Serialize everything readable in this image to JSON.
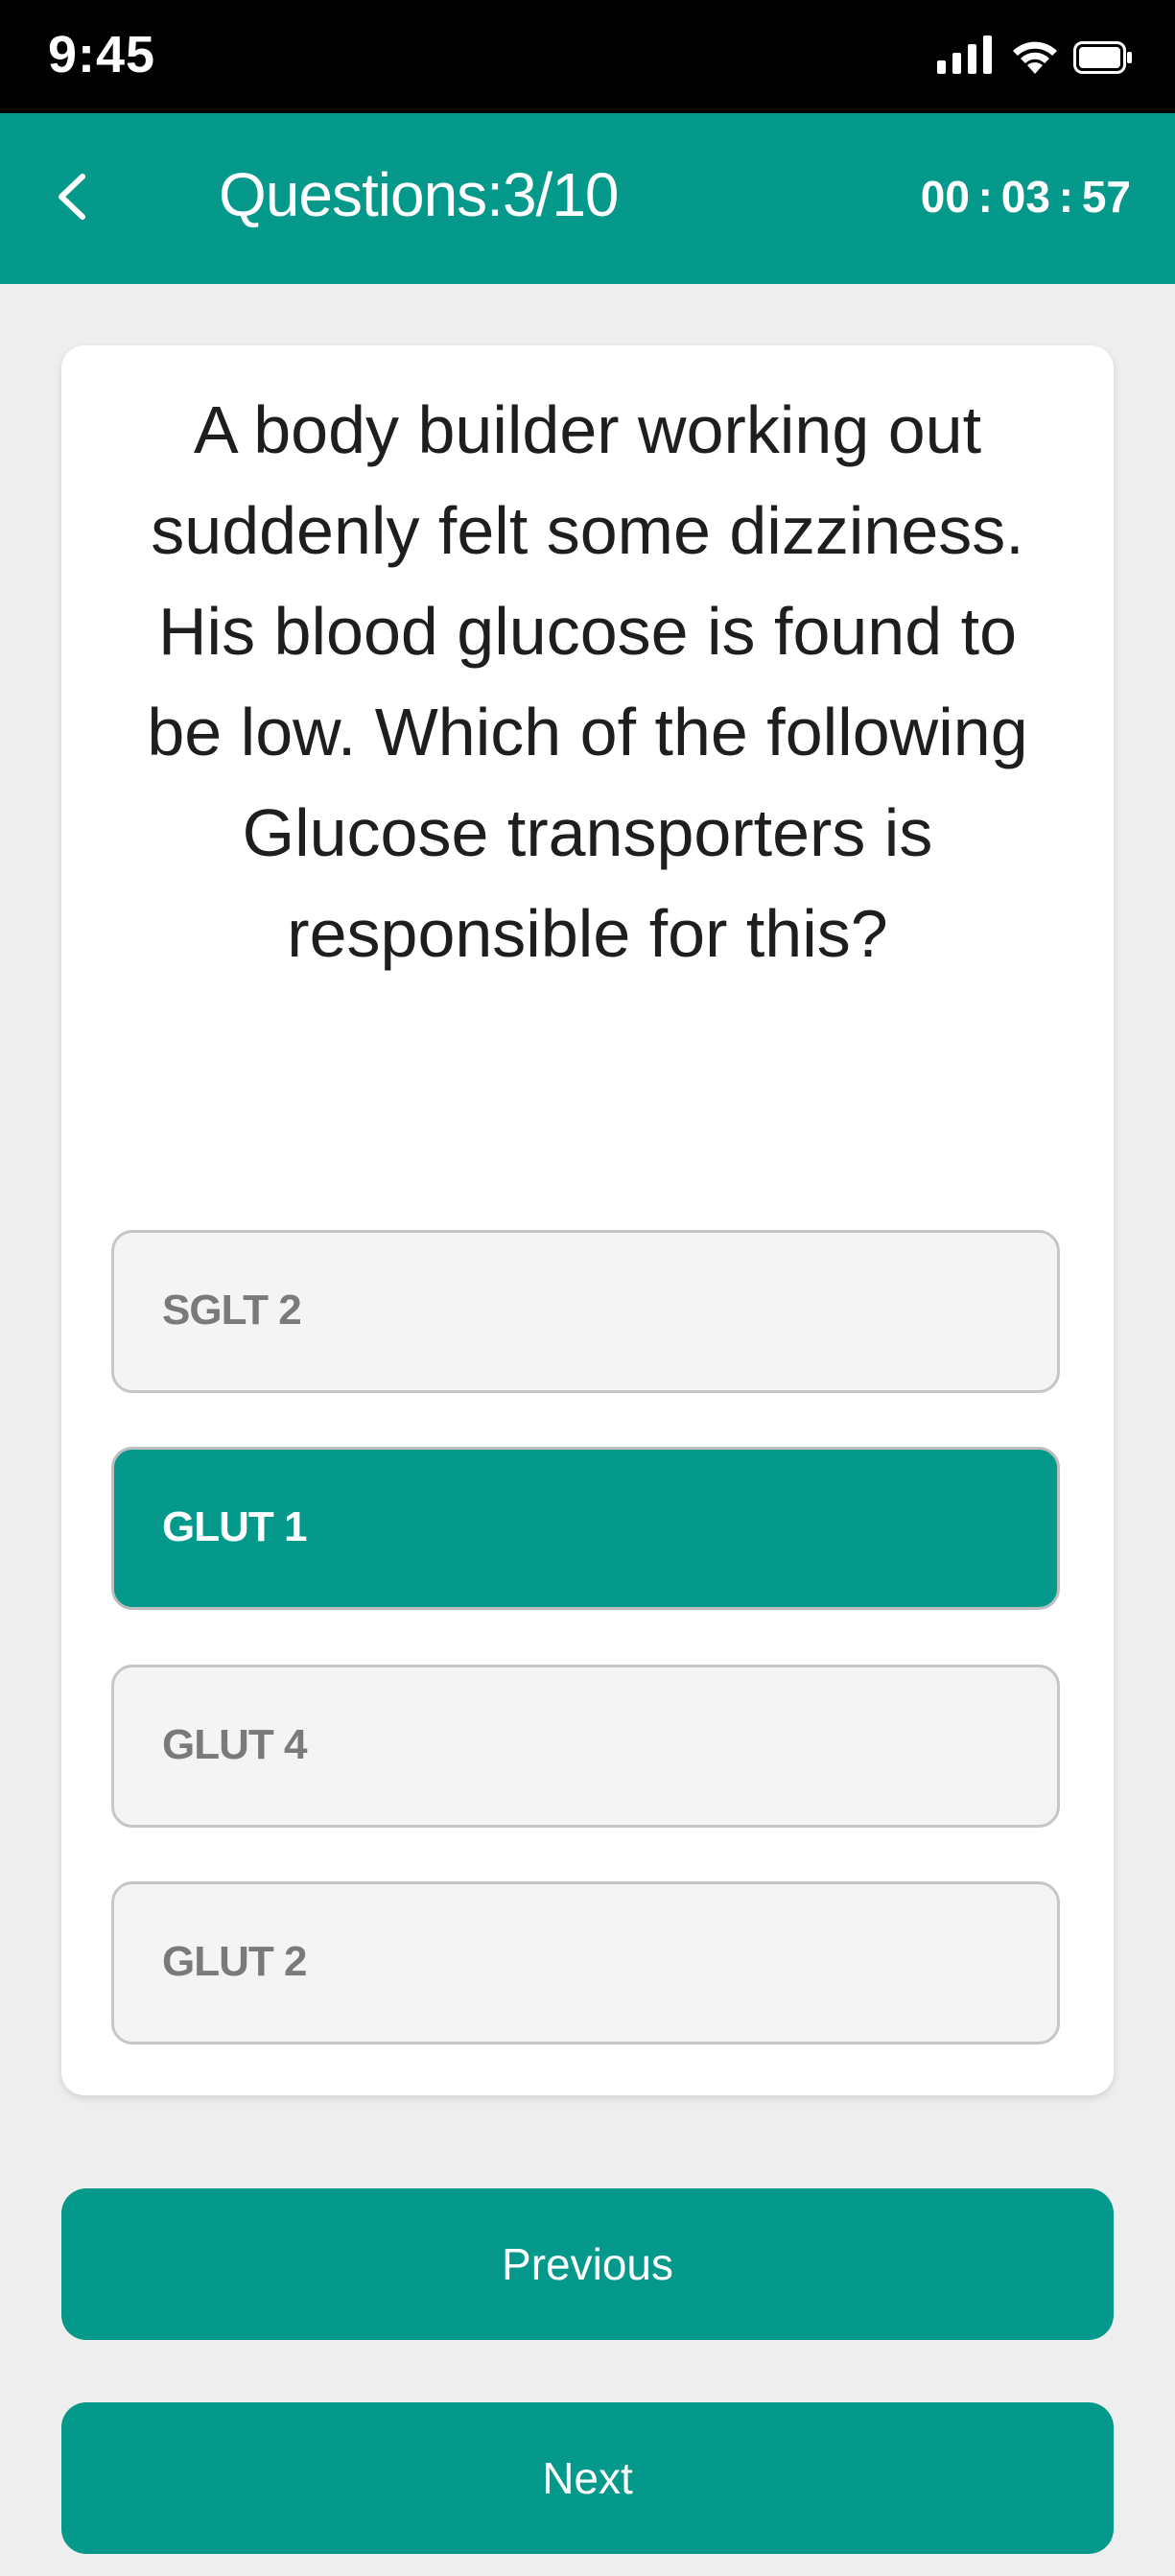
{
  "status_bar": {
    "time": "9:45",
    "icons": [
      "signal-icon",
      "wifi-icon",
      "battery-icon"
    ]
  },
  "header": {
    "title": "Questions:3/10",
    "timer": "00 : 03 : 57",
    "back_icon": "chevron-left-icon"
  },
  "question": {
    "text": "A body builder working out suddenly felt some dizziness. His blood glucose is found to be low. Which of the following Glucose transporters is responsible for this?",
    "options": [
      {
        "label": "SGLT 2",
        "selected": false
      },
      {
        "label": "GLUT 1",
        "selected": true
      },
      {
        "label": "GLUT 4",
        "selected": false
      },
      {
        "label": "GLUT 2",
        "selected": false
      }
    ]
  },
  "navigation": {
    "previous_label": "Previous",
    "next_label": "Next"
  },
  "colors": {
    "accent": "#04998a",
    "background": "#eeeeee",
    "status_bar": "#000000"
  }
}
